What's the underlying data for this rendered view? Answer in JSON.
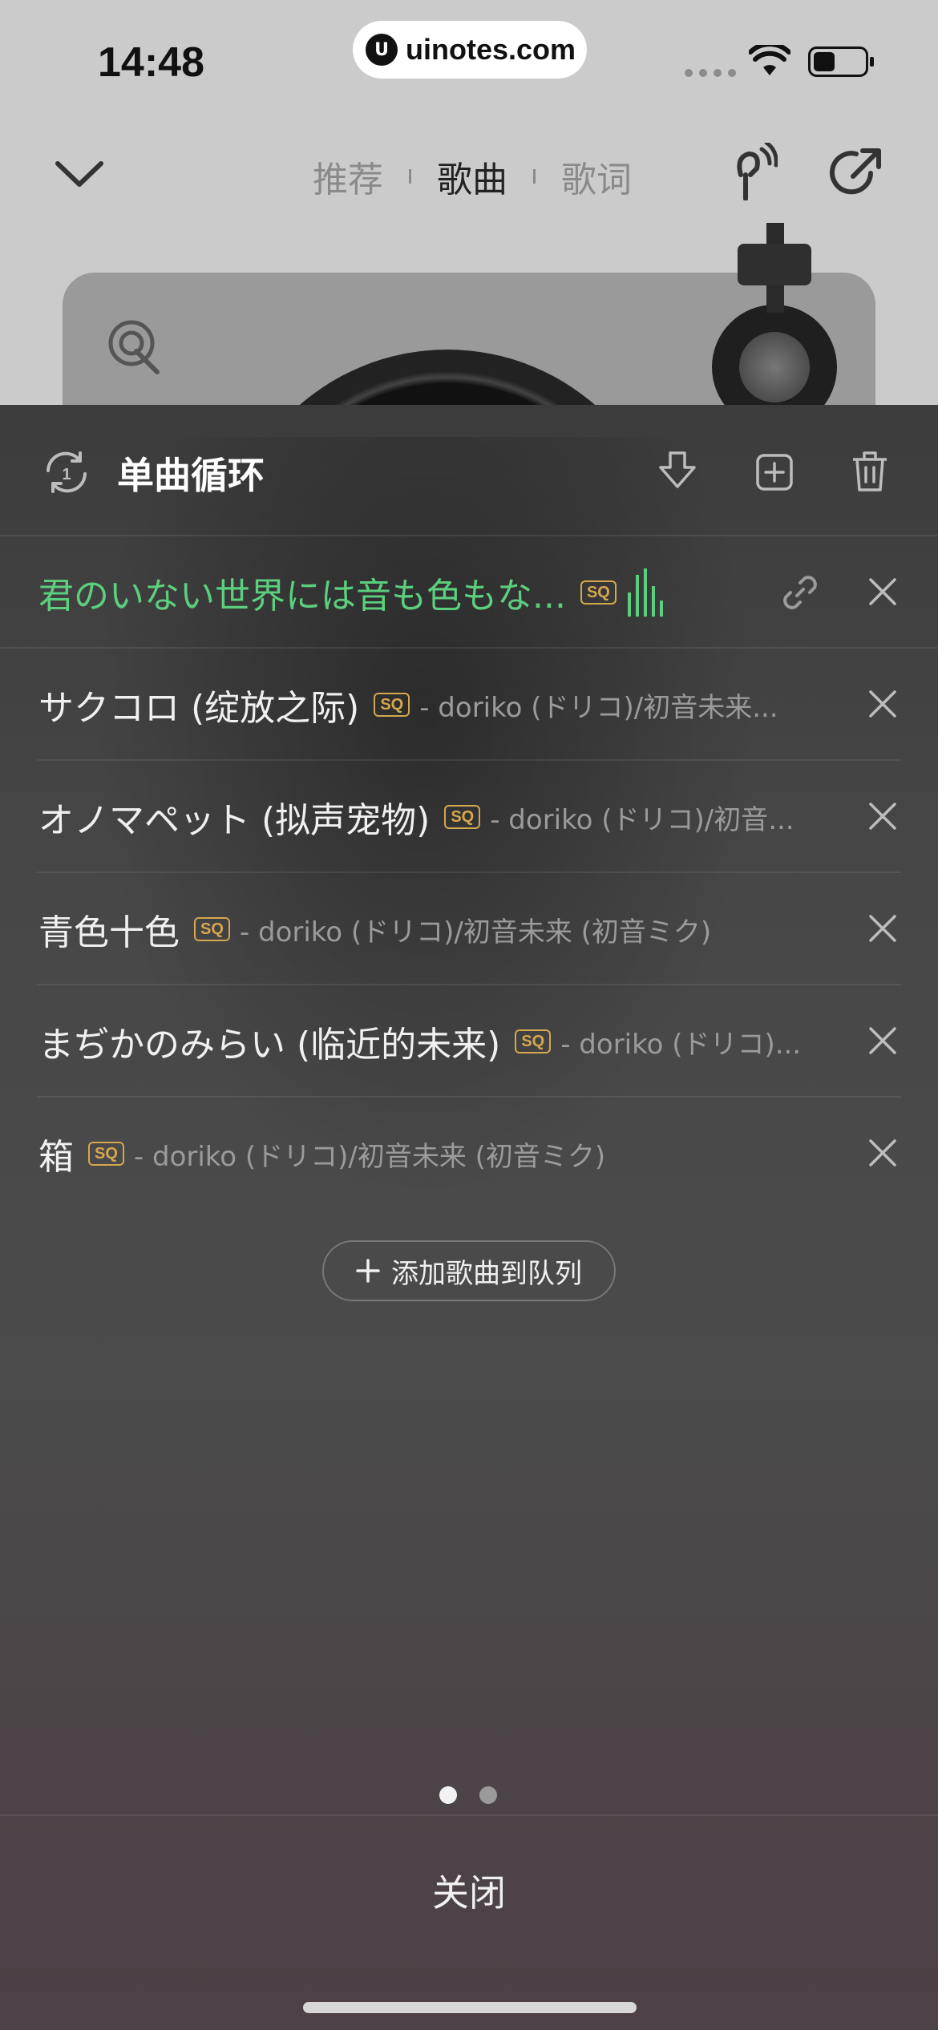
{
  "status_bar": {
    "time": "14:48",
    "url": "uinotes.com",
    "url_logo": "U"
  },
  "player_header": {
    "tabs": [
      {
        "label": "推荐",
        "active": false
      },
      {
        "label": "歌曲",
        "active": true
      },
      {
        "label": "歌词",
        "active": false
      }
    ]
  },
  "queue": {
    "mode_label": "单曲循环",
    "songs": [
      {
        "title": "君のいない世界には音も色もな...",
        "badge": "SQ",
        "artist": "",
        "playing": true
      },
      {
        "title": "サクコロ (绽放之际)",
        "badge": "SQ",
        "artist": "- doriko (ドリコ)/初音未来...",
        "playing": false
      },
      {
        "title": "オノマペット (拟声宠物)",
        "badge": "SQ",
        "artist": "- doriko (ドリコ)/初音...",
        "playing": false
      },
      {
        "title": "青色十色",
        "badge": "SQ",
        "artist": "- doriko (ドリコ)/初音未来 (初音ミク)",
        "playing": false
      },
      {
        "title": "まぢかのみらい (临近的未来)",
        "badge": "SQ",
        "artist": "- doriko (ドリコ)...",
        "playing": false
      },
      {
        "title": "箱",
        "badge": "SQ",
        "artist": "- doriko (ドリコ)/初音未来 (初音ミク)",
        "playing": false
      }
    ],
    "add_button_label": "添加歌曲到队列",
    "close_label": "关闭",
    "page_indicator": {
      "count": 2,
      "active_index": 0
    }
  },
  "colors": {
    "playing": "#5ccf7e",
    "badge": "#d4a84e",
    "sheet_bg": "#474747"
  }
}
